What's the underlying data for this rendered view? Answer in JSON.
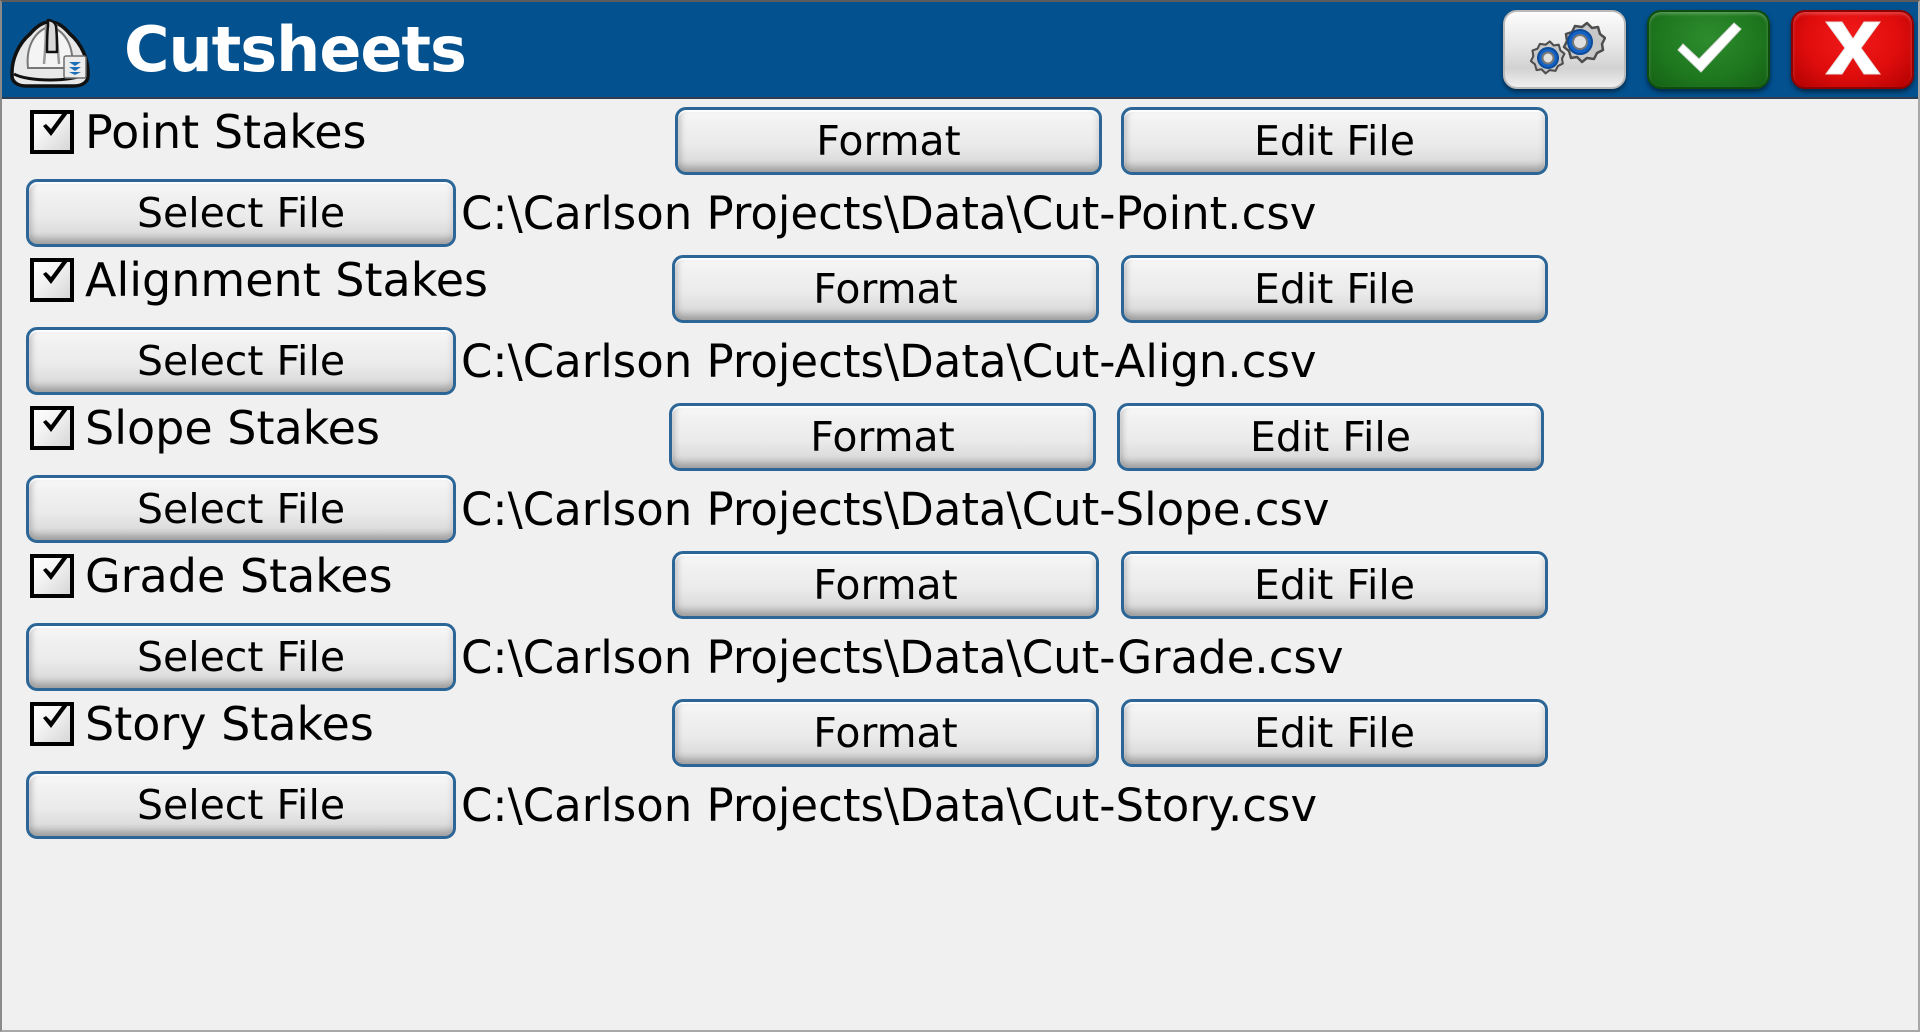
{
  "window": {
    "title": "Cutsheets",
    "logo_icon": "hard-hat-icon",
    "titlebar_color": "#03518f"
  },
  "titlebar_buttons": [
    {
      "name": "settings-button",
      "icon": "gears-icon",
      "label": ""
    },
    {
      "name": "confirm-button",
      "icon": "check-icon",
      "label": ""
    },
    {
      "name": "cancel-button",
      "icon": "x-icon",
      "label": ""
    }
  ],
  "labels": {
    "select_file": "Select File",
    "format": "Format",
    "edit_file": "Edit File"
  },
  "rows": [
    {
      "id": "point",
      "checkbox_label": "Point Stakes",
      "checked": true,
      "path": "C:\\Carlson Projects\\Data\\Cut-Point.csv",
      "select_file": "Select File",
      "format": "Format",
      "edit_file": "Edit File"
    },
    {
      "id": "alignment",
      "checkbox_label": "Alignment Stakes",
      "checked": true,
      "path": "C:\\Carlson Projects\\Data\\Cut-Align.csv",
      "select_file": "Select File",
      "format": "Format",
      "edit_file": "Edit File"
    },
    {
      "id": "slope",
      "checkbox_label": "Slope Stakes",
      "checked": true,
      "path": "C:\\Carlson Projects\\Data\\Cut-Slope.csv",
      "select_file": "Select File",
      "format": "Format",
      "edit_file": "Edit File"
    },
    {
      "id": "grade",
      "checkbox_label": "Grade Stakes",
      "checked": true,
      "path": "C:\\Carlson Projects\\Data\\Cut-Grade.csv",
      "select_file": "Select File",
      "format": "Format",
      "edit_file": "Edit File"
    },
    {
      "id": "story",
      "checkbox_label": "Story Stakes",
      "checked": true,
      "path": "C:\\Carlson Projects\\Data\\Cut-Story.csv",
      "select_file": "Select File",
      "format": "Format",
      "edit_file": "Edit File"
    }
  ]
}
